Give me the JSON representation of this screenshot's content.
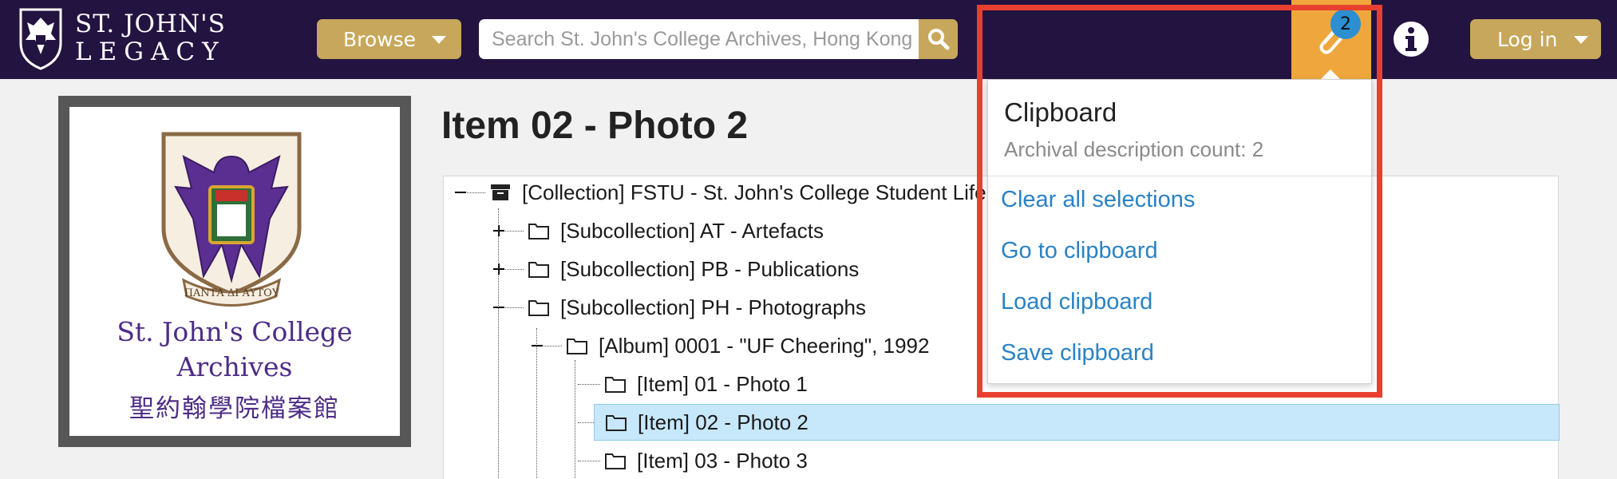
{
  "header": {
    "logo_line1": "ST. JOHN'S",
    "logo_line2": "LEGACY",
    "browse_label": "Browse",
    "search_placeholder": "Search St. John's College Archives, Hong Kong",
    "clipboard_count": "2",
    "login_label": "Log in"
  },
  "sidebar": {
    "logo_line1": "St. John's College",
    "logo_line2": "Archives",
    "logo_line3": "聖約翰學院檔案館",
    "crest_motto": "ΠΑΝΤΑ ΔΙ ΑΥΤΟΥ"
  },
  "main": {
    "title": "Item 02 - Photo 2",
    "tree": [
      {
        "label": "[Collection] FSTU - St. John's College Student Life",
        "level": 0,
        "icon": "archive-box-icon",
        "toggle": "minus"
      },
      {
        "label": "[Subcollection] AT - Artefacts",
        "level": 1,
        "icon": "folder-icon",
        "toggle": "plus"
      },
      {
        "label": "[Subcollection] PB - Publications",
        "level": 1,
        "icon": "folder-icon",
        "toggle": "plus"
      },
      {
        "label": "[Subcollection] PH - Photographs",
        "level": 1,
        "icon": "folder-icon",
        "toggle": "minus"
      },
      {
        "label": "[Album] 0001 - \"UF Cheering\", 1992",
        "level": 2,
        "icon": "folder-icon",
        "toggle": "minus"
      },
      {
        "label": "[Item] 01 - Photo 1",
        "level": 3,
        "icon": "folder-icon",
        "toggle": ""
      },
      {
        "label": "[Item] 02 - Photo 2",
        "level": 3,
        "icon": "folder-icon",
        "toggle": "",
        "selected": true
      },
      {
        "label": "[Item] 03 - Photo 3",
        "level": 3,
        "icon": "folder-icon",
        "toggle": ""
      }
    ]
  },
  "clipboard_menu": {
    "title": "Clipboard",
    "subtitle": "Archival description count: 2",
    "items": [
      "Clear all selections",
      "Go to clipboard",
      "Load clipboard",
      "Save clipboard"
    ]
  },
  "colors": {
    "header_bg": "#231340",
    "gold": "#c7a75b",
    "clipboard_orange": "#efa73d",
    "badge_blue": "#2b8fd1",
    "link_blue": "#2a82c3",
    "highlight_red": "#e8402f",
    "selected_row": "#c7e7fa"
  }
}
